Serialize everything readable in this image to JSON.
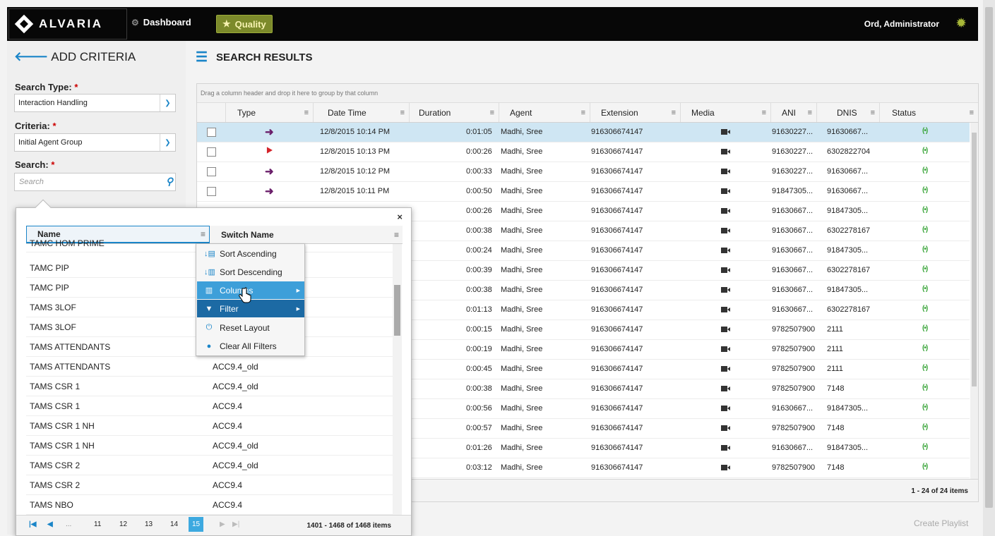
{
  "app": {
    "brand": "ALVARIA",
    "nav": {
      "dashboard": "Dashboard",
      "quality": "Quality"
    },
    "user": "Ord, Administrator"
  },
  "criteria": {
    "title": "ADD CRITERIA",
    "search_type_label": "Search Type:",
    "search_type_value": "Interaction Handling",
    "criteria_label": "Criteria:",
    "criteria_value": "Initial Agent Group",
    "search_label": "Search:",
    "search_placeholder": "Search",
    "required_mark": "*"
  },
  "results": {
    "title": "SEARCH RESULTS",
    "group_hint": "Drag a column header and drop it here to group by that column",
    "columns": [
      "Type",
      "Date Time",
      "Duration",
      "Agent",
      "Extension",
      "Media",
      "ANI",
      "DNIS",
      "Status"
    ],
    "rows": [
      {
        "type": "inbound",
        "datetime": "12/8/2015 10:14 PM",
        "duration": "0:01:05",
        "agent": "Madhi, Sree",
        "extension": "916306674147",
        "ani": "91630227...",
        "dnis": "91630667...",
        "selected": true
      },
      {
        "type": "transfer",
        "datetime": "12/8/2015 10:13 PM",
        "duration": "0:00:26",
        "agent": "Madhi, Sree",
        "extension": "916306674147",
        "ani": "91630227...",
        "dnis": "6302822704"
      },
      {
        "type": "inbound",
        "datetime": "12/8/2015 10:12 PM",
        "duration": "0:00:33",
        "agent": "Madhi, Sree",
        "extension": "916306674147",
        "ani": "91630227...",
        "dnis": "91630667..."
      },
      {
        "type": "inbound",
        "datetime": "12/8/2015 10:11 PM",
        "duration": "0:00:50",
        "agent": "Madhi, Sree",
        "extension": "916306674147",
        "ani": "91847305...",
        "dnis": "91630667..."
      },
      {
        "duration": "0:00:26",
        "agent": "Madhi, Sree",
        "extension": "916306674147",
        "ani": "91630667...",
        "dnis": "91847305..."
      },
      {
        "duration": "0:00:38",
        "agent": "Madhi, Sree",
        "extension": "916306674147",
        "ani": "91630667...",
        "dnis": "6302278167"
      },
      {
        "duration": "0:00:24",
        "agent": "Madhi, Sree",
        "extension": "916306674147",
        "ani": "91630667...",
        "dnis": "91847305..."
      },
      {
        "duration": "0:00:39",
        "agent": "Madhi, Sree",
        "extension": "916306674147",
        "ani": "91630667...",
        "dnis": "6302278167"
      },
      {
        "duration": "0:00:38",
        "agent": "Madhi, Sree",
        "extension": "916306674147",
        "ani": "91630667...",
        "dnis": "91847305..."
      },
      {
        "duration": "0:01:13",
        "agent": "Madhi, Sree",
        "extension": "916306674147",
        "ani": "91630667...",
        "dnis": "6302278167"
      },
      {
        "duration": "0:00:15",
        "agent": "Madhi, Sree",
        "extension": "916306674147",
        "ani": "9782507900",
        "dnis": "2111"
      },
      {
        "duration": "0:00:19",
        "agent": "Madhi, Sree",
        "extension": "916306674147",
        "ani": "9782507900",
        "dnis": "2111"
      },
      {
        "duration": "0:00:45",
        "agent": "Madhi, Sree",
        "extension": "916306674147",
        "ani": "9782507900",
        "dnis": "2111"
      },
      {
        "duration": "0:00:38",
        "agent": "Madhi, Sree",
        "extension": "916306674147",
        "ani": "9782507900",
        "dnis": "7148"
      },
      {
        "duration": "0:00:56",
        "agent": "Madhi, Sree",
        "extension": "916306674147",
        "ani": "91630667...",
        "dnis": "91847305..."
      },
      {
        "duration": "0:00:57",
        "agent": "Madhi, Sree",
        "extension": "916306674147",
        "ani": "9782507900",
        "dnis": "7148"
      },
      {
        "duration": "0:01:26",
        "agent": "Madhi, Sree",
        "extension": "916306674147",
        "ani": "91630667...",
        "dnis": "91847305..."
      },
      {
        "duration": "0:03:12",
        "agent": "Madhi, Sree",
        "extension": "916306674147",
        "ani": "9782507900",
        "dnis": "7148"
      }
    ],
    "item_count": "1 - 24 of 24 items",
    "create_playlist": "Create Playlist"
  },
  "popup": {
    "columns": [
      "Name",
      "Switch Name"
    ],
    "rows": [
      {
        "name": "TAMC HOM PRIME",
        "switch": ""
      },
      {
        "name": "TAMC PIP",
        "switch": ""
      },
      {
        "name": "TAMC PIP",
        "switch": ""
      },
      {
        "name": "TAMS 3LOF",
        "switch": ""
      },
      {
        "name": "TAMS 3LOF",
        "switch": ""
      },
      {
        "name": "TAMS ATTENDANTS",
        "switch": ""
      },
      {
        "name": "TAMS ATTENDANTS",
        "switch": "ACC9.4_old"
      },
      {
        "name": "TAMS CSR 1",
        "switch": "ACC9.4_old"
      },
      {
        "name": "TAMS CSR 1",
        "switch": "ACC9.4"
      },
      {
        "name": "TAMS CSR 1 NH",
        "switch": "ACC9.4"
      },
      {
        "name": "TAMS CSR 1 NH",
        "switch": "ACC9.4_old"
      },
      {
        "name": "TAMS CSR 2",
        "switch": "ACC9.4_old"
      },
      {
        "name": "TAMS CSR 2",
        "switch": "ACC9.4"
      },
      {
        "name": "TAMS NBO",
        "switch": "ACC9.4"
      }
    ],
    "pager": {
      "first": "|◀",
      "prev": "◀",
      "ellipsis": "...",
      "pages": [
        "11",
        "12",
        "13",
        "14",
        "15"
      ],
      "current": "15",
      "next": "▶",
      "last": "▶|",
      "info": "1401 - 1468 of 1468 items"
    },
    "close": "×"
  },
  "menu": {
    "items": [
      {
        "label": "Sort Ascending",
        "icon": "sort-asc-icon"
      },
      {
        "label": "Sort Descending",
        "icon": "sort-desc-icon"
      },
      {
        "label": "Columns",
        "icon": "columns-icon",
        "submenu": true,
        "highlight": "light"
      },
      {
        "label": "Filter",
        "icon": "filter-icon",
        "submenu": true,
        "highlight": "dark"
      },
      {
        "label": "Reset Layout",
        "icon": "reset-icon"
      },
      {
        "label": "Clear All Filters",
        "icon": "clear-filter-icon"
      }
    ]
  },
  "colors": {
    "accent": "#1a85c8",
    "quality": "#7c8a2b",
    "selected_row": "#cfe6f3",
    "status": "#3aa53a",
    "inbound": "#6a1e6a",
    "transfer": "#d4232a"
  }
}
